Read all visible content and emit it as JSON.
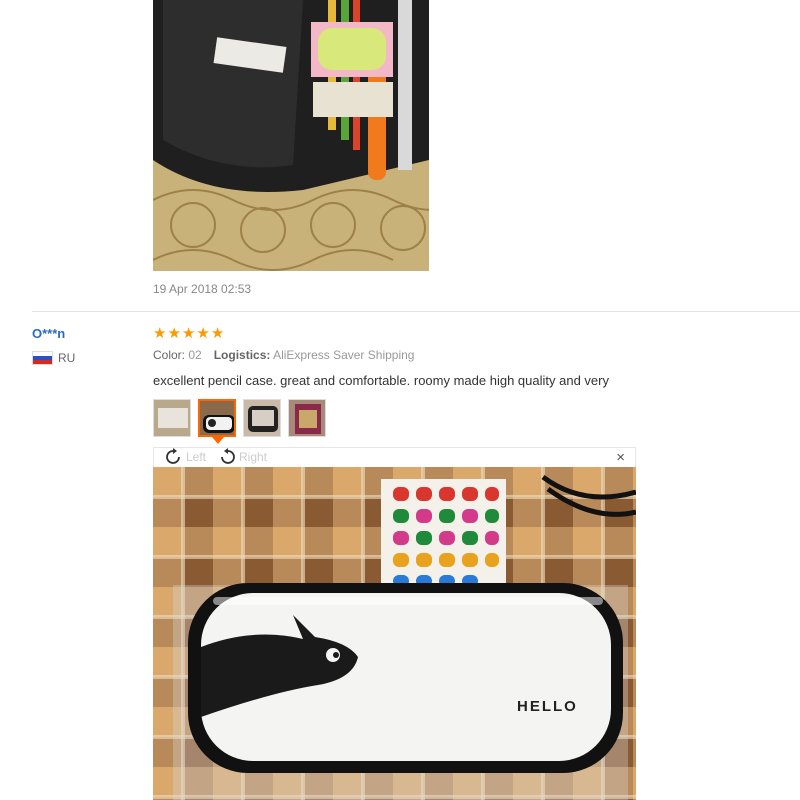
{
  "previous_review": {
    "date": "19 Apr 2018 02:53"
  },
  "review": {
    "reviewer": "O***n",
    "country_code": "RU",
    "rating": 5,
    "color_label": "Color:",
    "color_value": "02",
    "logistics_label": "Logistics:",
    "logistics_value": "AliExpress Saver Shipping",
    "text": "excellent pencil case. great and comfortable. roomy made high quality and very",
    "thumbnail_count": 4,
    "active_thumbnail": 1
  },
  "viewer": {
    "rotate_left_label": "Left",
    "rotate_right_label": "Right",
    "close_label": "×",
    "photo_text": "HELLO"
  },
  "colors": {
    "star": "#ff9900",
    "link": "#2a6bc2",
    "active_thumb_border": "#ff6600"
  },
  "icons": {
    "star": "star-icon",
    "flag": "russia-flag-icon",
    "rotate_left": "rotate-left-icon",
    "rotate_right": "rotate-right-icon",
    "close": "close-icon"
  }
}
